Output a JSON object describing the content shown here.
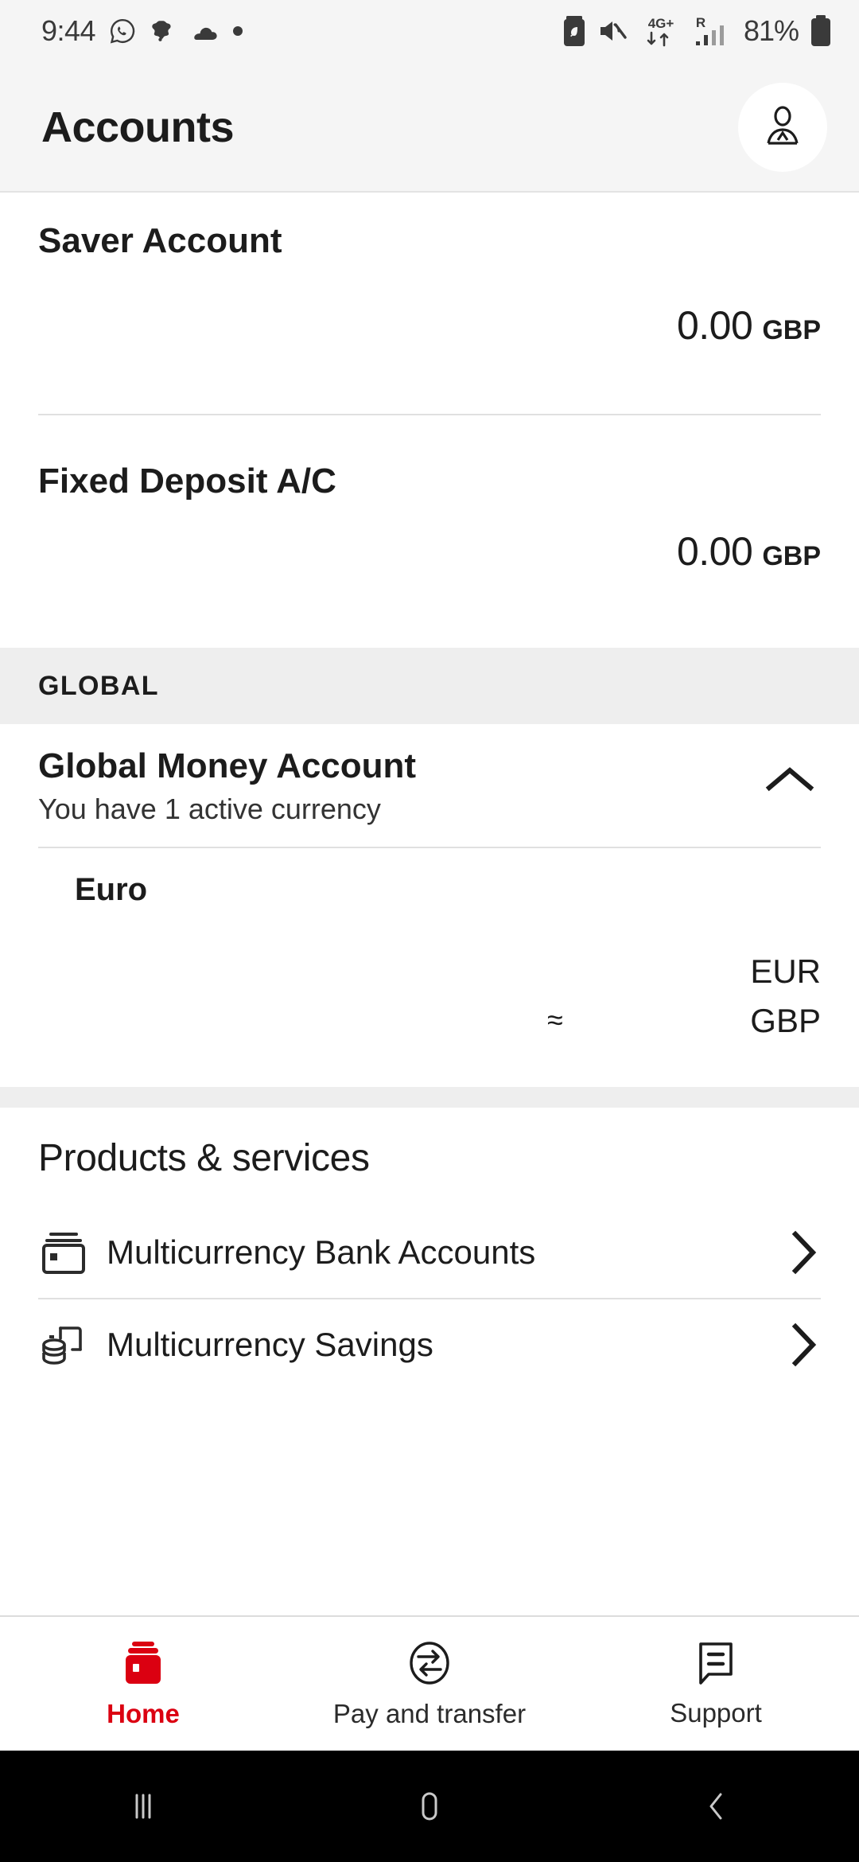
{
  "status_bar": {
    "time": "9:44",
    "battery_percent": "81%",
    "network_type": "4G+",
    "roaming_indicator": "R",
    "left_icons": [
      "whatsapp-icon",
      "app-notification-icon",
      "cloud-icon",
      "dot-icon"
    ],
    "right_icons": [
      "battery-saver-icon",
      "mute-icon",
      "4g-plus-data-icon",
      "roaming-signal-icon",
      "battery-icon"
    ]
  },
  "header": {
    "title": "Accounts",
    "avatar_icon": "profile-avatar-icon"
  },
  "accounts": [
    {
      "name": "Saver Account",
      "amount": "0.00",
      "currency": "GBP"
    },
    {
      "name": "Fixed Deposit A/C",
      "amount": "0.00",
      "currency": "GBP"
    }
  ],
  "global_section": {
    "band_label": "GLOBAL",
    "account_title": "Global Money Account",
    "account_subtitle": "You have 1 active currency",
    "collapse_icon": "chevron-up-icon",
    "currencies": [
      {
        "name": "Euro",
        "primary_amount": "",
        "primary_code": "EUR",
        "approx_symbol": "≈",
        "converted_amount": "",
        "converted_code": "GBP"
      }
    ]
  },
  "products": {
    "title": "Products & services",
    "items": [
      {
        "label": "Multicurrency Bank Accounts",
        "icon": "bank-cards-icon",
        "chevron": "chevron-right-icon"
      },
      {
        "label": "Multicurrency Savings",
        "icon": "savings-coins-icon",
        "chevron": "chevron-right-icon"
      }
    ]
  },
  "bottom_nav": {
    "tabs": [
      {
        "label": "Home",
        "icon": "wallet-icon",
        "active": true
      },
      {
        "label": "Pay and transfer",
        "icon": "transfer-circle-icon",
        "active": false
      },
      {
        "label": "Support",
        "icon": "chat-bubble-icon",
        "active": false
      }
    ]
  },
  "android_nav": {
    "recents": "recents-icon",
    "home": "home-pill-icon",
    "back": "back-chevron-icon"
  },
  "colors": {
    "brand_red": "#db0011",
    "band_gray": "#eeeeee",
    "statusbar_gray": "#f5f5f5",
    "text_primary": "#1c1c1c"
  }
}
